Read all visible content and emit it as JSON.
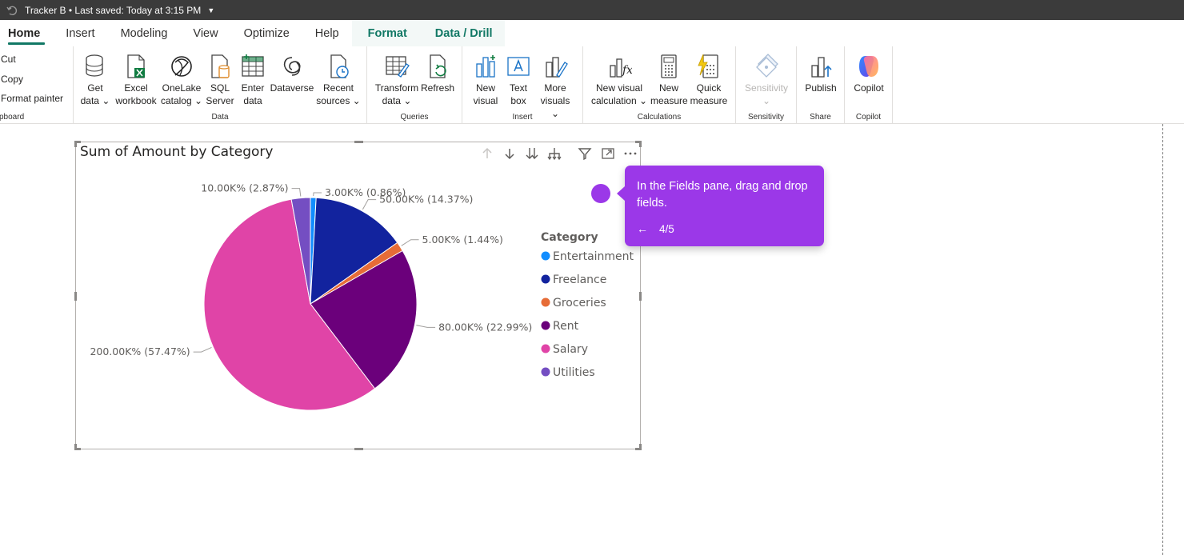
{
  "titlebar": {
    "text": "Tracker B • Last saved: Today at 3:15 PM"
  },
  "tabs": [
    {
      "label": "Home",
      "active": true
    },
    {
      "label": "Insert"
    },
    {
      "label": "Modeling"
    },
    {
      "label": "View"
    },
    {
      "label": "Optimize"
    },
    {
      "label": "Help"
    },
    {
      "label": "Format",
      "contextual": true
    },
    {
      "label": "Data / Drill",
      "contextual": true
    }
  ],
  "ribbon": {
    "clipboard": {
      "cut": "Cut",
      "copy": "Copy",
      "format_painter": "Format painter",
      "label": "pboard"
    },
    "data": {
      "label": "Data",
      "get_data": [
        "Get",
        "data ⌄"
      ],
      "excel": [
        "Excel",
        "workbook"
      ],
      "onelake": [
        "OneLake",
        "catalog ⌄"
      ],
      "sql": [
        "SQL",
        "Server"
      ],
      "enter": [
        "Enter",
        "data"
      ],
      "dataverse": [
        "Dataverse"
      ],
      "recent": [
        "Recent",
        "sources ⌄"
      ]
    },
    "queries": {
      "label": "Queries",
      "transform": [
        "Transform",
        "data ⌄"
      ],
      "refresh": [
        "Refresh"
      ]
    },
    "insert": {
      "label": "Insert",
      "new_visual": [
        "New",
        "visual"
      ],
      "text_box": [
        "Text",
        "box"
      ],
      "more_visuals": [
        "More",
        "visuals ⌄"
      ]
    },
    "calculations": {
      "label": "Calculations",
      "new_visual_calc": [
        "New visual",
        "calculation ⌄"
      ],
      "new_measure": [
        "New",
        "measure"
      ],
      "quick_measure": [
        "Quick",
        "measure"
      ]
    },
    "sensitivity": {
      "label": "Sensitivity",
      "button": [
        "Sensitivity",
        "⌄"
      ]
    },
    "share": {
      "label": "Share",
      "publish": [
        "Publish"
      ]
    },
    "copilot": {
      "label": "Copilot",
      "button": [
        "Copilot"
      ]
    }
  },
  "visual": {
    "title": "Sum of Amount by Category"
  },
  "chart_data": {
    "type": "pie",
    "title": "Sum of Amount by Category",
    "legend_title": "Category",
    "legend_position": "right",
    "categories": [
      "Entertainment",
      "Freelance",
      "Groceries",
      "Rent",
      "Salary",
      "Utilities"
    ],
    "values": [
      3,
      50,
      5,
      80,
      200,
      10
    ],
    "percents": [
      0.86,
      14.37,
      1.44,
      22.99,
      57.47,
      2.87
    ],
    "labels": [
      "3.00K% (0.86%)",
      "50.00K% (14.37%)",
      "5.00K% (1.44%)",
      "80.00K% (22.99%)",
      "200.00K% (57.47%)",
      "10.00K% (2.87%)"
    ],
    "colors": [
      "#118dff",
      "#12239e",
      "#e66c37",
      "#6b007b",
      "#e044a7",
      "#744ec2"
    ]
  },
  "callout": {
    "text": "In the Fields pane, drag and drop fields.",
    "back": "←",
    "step": "4/5",
    "color": "#9b38e8"
  }
}
